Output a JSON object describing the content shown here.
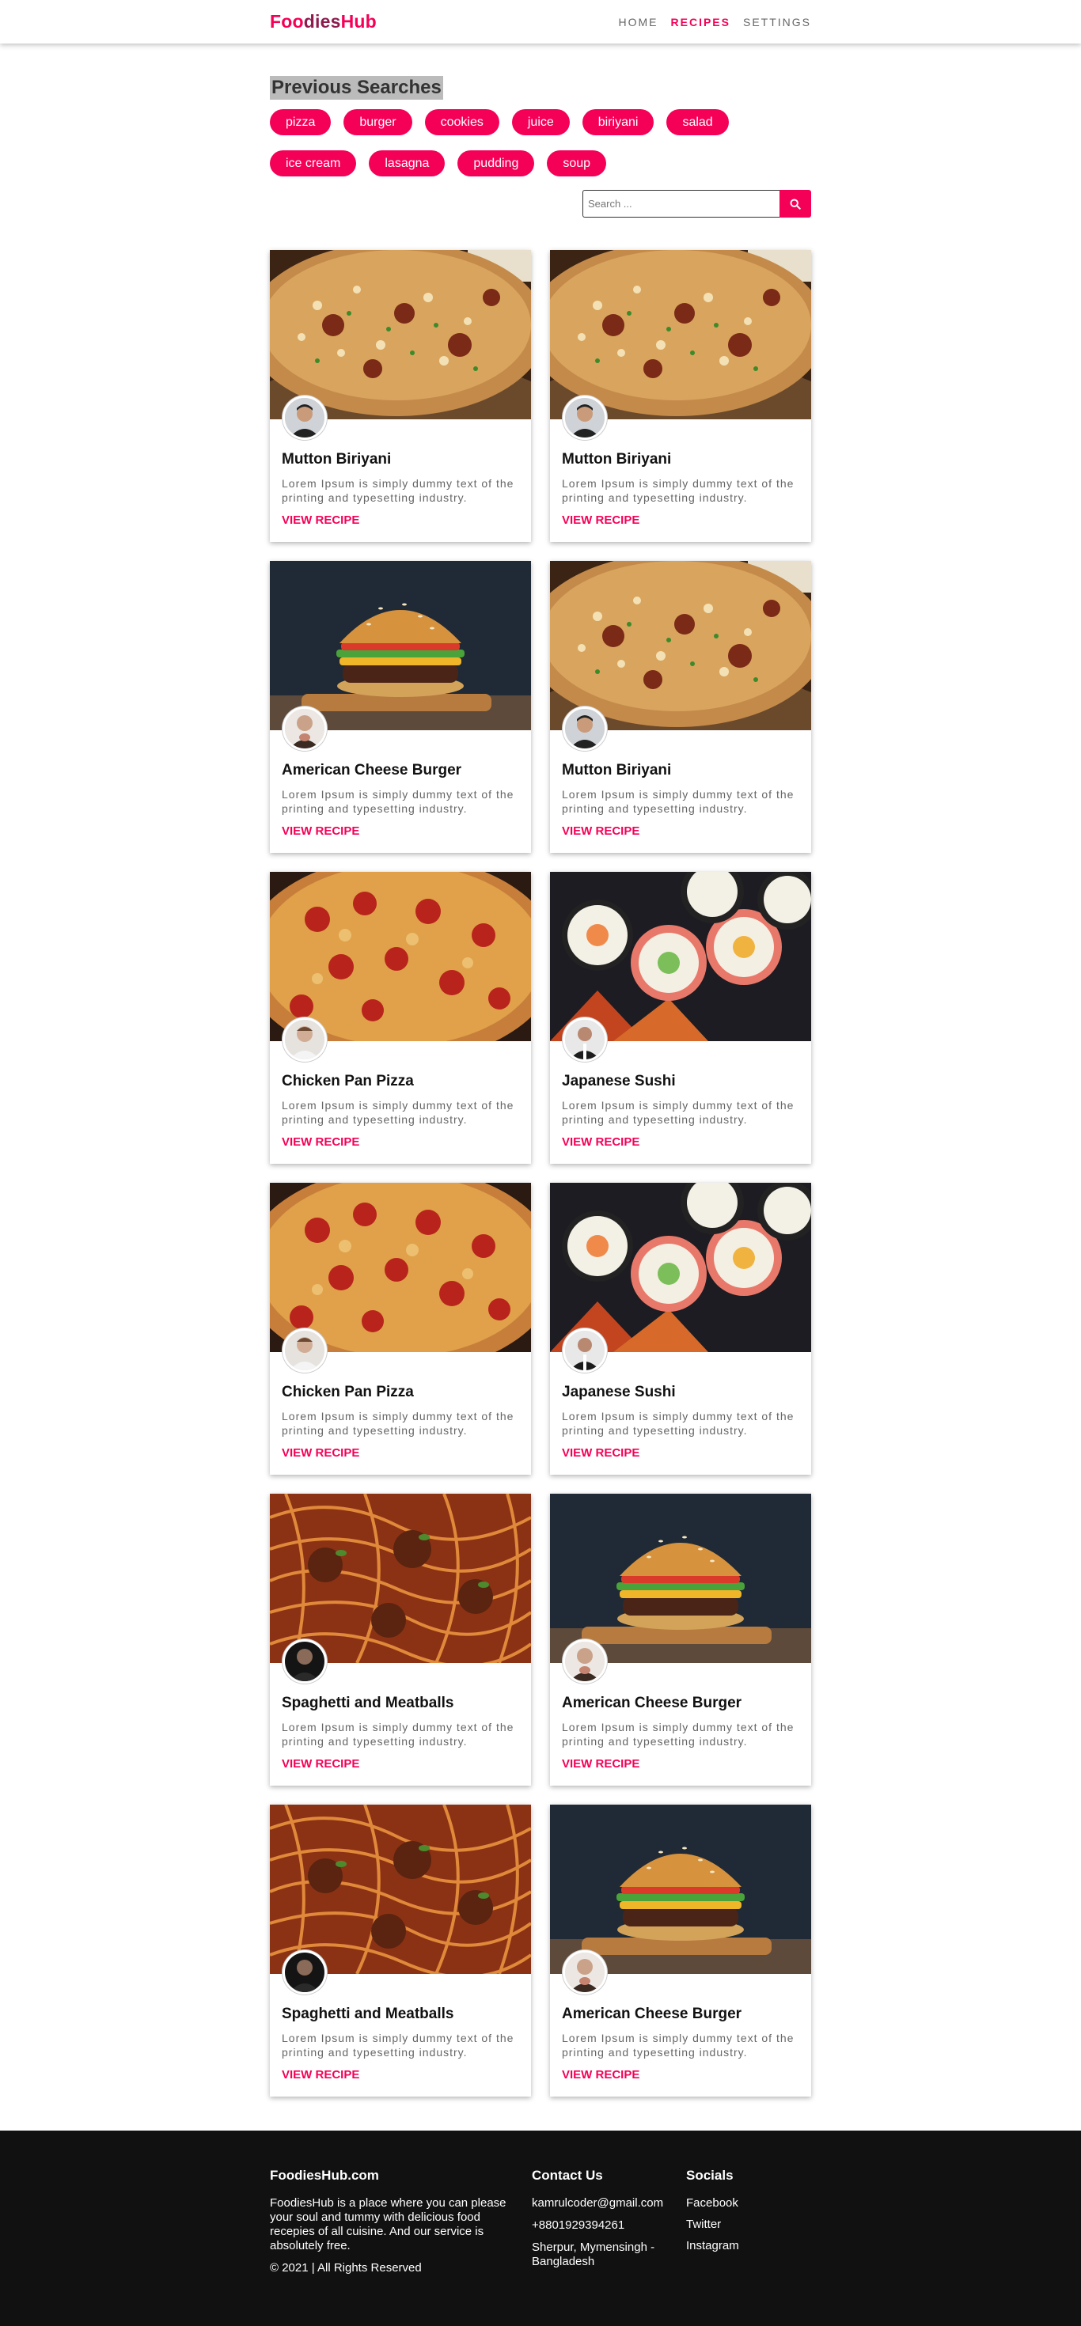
{
  "brand": {
    "part1": "Foo",
    "part2": "dies",
    "part3": "Hub"
  },
  "nav": {
    "home": "HOME",
    "recipes": "RECIPES",
    "settings": "SETTINGS"
  },
  "previous": {
    "title": "Previous Searches",
    "chips": [
      "pizza",
      "burger",
      "cookies",
      "juice",
      "biriyani",
      "salad",
      "ice cream",
      "lasagna",
      "pudding",
      "soup"
    ]
  },
  "search": {
    "placeholder": "Search ..."
  },
  "cards": [
    {
      "title": "Mutton Biriyani",
      "desc": "Lorem Ipsum is simply dummy text of the printing and typesetting industry.",
      "link": "VIEW RECIPE",
      "image": "biriyani",
      "avatar": "chef-a"
    },
    {
      "title": "Mutton Biriyani",
      "desc": "Lorem Ipsum is simply dummy text of the printing and typesetting industry.",
      "link": "VIEW RECIPE",
      "image": "biriyani",
      "avatar": "chef-a"
    },
    {
      "title": "American Cheese Burger",
      "desc": "Lorem Ipsum is simply dummy text of the printing and typesetting industry.",
      "link": "VIEW RECIPE",
      "image": "burger",
      "avatar": "chef-b"
    },
    {
      "title": "Mutton Biriyani",
      "desc": "Lorem Ipsum is simply dummy text of the printing and typesetting industry.",
      "link": "VIEW RECIPE",
      "image": "biriyani",
      "avatar": "chef-a"
    },
    {
      "title": "Chicken Pan Pizza",
      "desc": "Lorem Ipsum is simply dummy text of the printing and typesetting industry.",
      "link": "VIEW RECIPE",
      "image": "pizza",
      "avatar": "chef-c"
    },
    {
      "title": "Japanese Sushi",
      "desc": "Lorem Ipsum is simply dummy text of the printing and typesetting industry.",
      "link": "VIEW RECIPE",
      "image": "sushi",
      "avatar": "chef-d"
    },
    {
      "title": "Chicken Pan Pizza",
      "desc": "Lorem Ipsum is simply dummy text of the printing and typesetting industry.",
      "link": "VIEW RECIPE",
      "image": "pizza",
      "avatar": "chef-c"
    },
    {
      "title": "Japanese Sushi",
      "desc": "Lorem Ipsum is simply dummy text of the printing and typesetting industry.",
      "link": "VIEW RECIPE",
      "image": "sushi",
      "avatar": "chef-d"
    },
    {
      "title": "Spaghetti and Meatballs",
      "desc": "Lorem Ipsum is simply dummy text of the printing and typesetting industry.",
      "link": "VIEW RECIPE",
      "image": "spaghetti",
      "avatar": "chef-e"
    },
    {
      "title": "American Cheese Burger",
      "desc": "Lorem Ipsum is simply dummy text of the printing and typesetting industry.",
      "link": "VIEW RECIPE",
      "image": "burger",
      "avatar": "chef-b"
    },
    {
      "title": "Spaghetti and Meatballs",
      "desc": "Lorem Ipsum is simply dummy text of the printing and typesetting industry.",
      "link": "VIEW RECIPE",
      "image": "spaghetti",
      "avatar": "chef-e"
    },
    {
      "title": "American Cheese Burger",
      "desc": "Lorem Ipsum is simply dummy text of the printing and typesetting industry.",
      "link": "VIEW RECIPE",
      "image": "burger",
      "avatar": "chef-b"
    }
  ],
  "footer": {
    "about": {
      "heading": "FoodiesHub.com",
      "text": "FoodiesHub is a place where you can please your soul and tummy with delicious food recepies of all cuisine. And our service is absolutely free.",
      "copyright": "© 2021 | All Rights Reserved"
    },
    "contact": {
      "heading": "Contact Us",
      "email": "kamrulcoder@gmail.com",
      "phone": "+8801929394261",
      "address": "Sherpur, Mymensingh - Bangladesh"
    },
    "socials": {
      "heading": "Socials",
      "links": [
        "Facebook",
        "Twitter",
        "Instagram"
      ]
    }
  },
  "colors": {
    "accent": "#f50057",
    "footer_bg": "#111111"
  },
  "icons": {
    "search_button": "search-icon"
  }
}
